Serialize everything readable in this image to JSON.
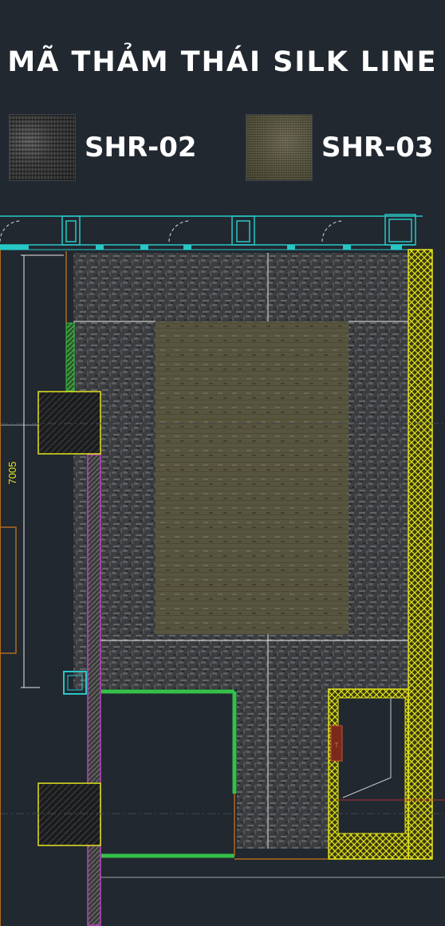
{
  "title": "MÃ THẢM THÁI SILK LINE",
  "samples": [
    {
      "code": "SHR-02"
    },
    {
      "code": "SHR-03"
    }
  ],
  "plan": {
    "dimension_label": "7005",
    "tag_label": "T"
  },
  "colors": {
    "background": "#212830",
    "carpet_dark": "#3c3e41",
    "carpet_light": "#5a5841",
    "cad_yellow": "#e4e41c",
    "cad_cyan": "#27c7c7",
    "cad_green": "#35c04a",
    "cad_magenta": "#c040c0",
    "cad_orange": "#b06b1e",
    "dimension": "#e4e41c"
  }
}
